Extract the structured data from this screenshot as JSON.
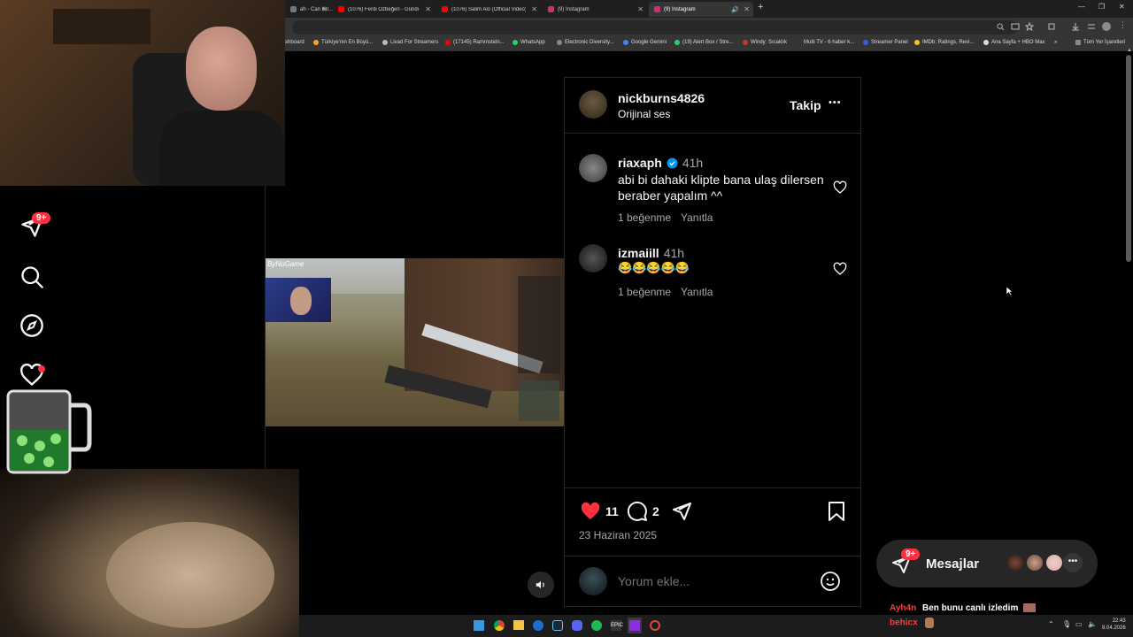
{
  "browser": {
    "tabs": [
      {
        "label": "ah - Can Kır...",
        "fav": "#777"
      },
      {
        "label": "(1076) Ferdi Özbeğen - Gündo...",
        "fav": "#ff0000"
      },
      {
        "label": "(1076) Salim Alo (Official Video)...",
        "fav": "#ff0000"
      },
      {
        "label": "(9) Instagram",
        "fav": "#d62976"
      },
      {
        "label": "(9) Instagram",
        "fav": "#d62976"
      }
    ],
    "new_tab": "+",
    "window_controls": [
      "—",
      "❐",
      "✕"
    ],
    "bookmarks": [
      {
        "label": "shboard",
        "color": "#888"
      },
      {
        "label": "Türkiye'nin En Büyü...",
        "color": "#f5a623"
      },
      {
        "label": "Livad For Streamers",
        "color": "#bbb"
      },
      {
        "label": "(17145) Rammstein...",
        "color": "#ff0000"
      },
      {
        "label": "WhatsApp",
        "color": "#25d366"
      },
      {
        "label": "Electronic Diversity...",
        "color": "#888"
      },
      {
        "label": "Google Gemini",
        "color": "#4285f4"
      },
      {
        "label": "(19) Alert Box / Stre...",
        "color": "#2ecc71"
      },
      {
        "label": "Windy: Sıcaklık",
        "color": "#c0392b"
      },
      {
        "label": "Multi TV - 6 haber k...",
        "color": "#333"
      },
      {
        "label": "Streamer Panel",
        "color": "#3b5bdb"
      },
      {
        "label": "IMDb: Ratings, Revi...",
        "color": "#f5c518"
      },
      {
        "label": "Ana Sayfa + HBO Max",
        "color": "#ddd"
      },
      {
        "label": "»",
        "color": "#353535"
      },
      {
        "label": "Tüm Yer İşaretleri",
        "color": "#888"
      }
    ]
  },
  "nav": {
    "notifications_badge": "9+"
  },
  "post": {
    "author": "nickburns4826",
    "audio": "Orijinal ses",
    "follow": "Takip",
    "more": "•••",
    "video_watermark": "ByNuGame",
    "comments": [
      {
        "user": "riaxaph",
        "verified": true,
        "time": "41h",
        "text": "abi bi dahaki klipte bana ulaş dilersen beraber yapalım ^^",
        "likes": "1 beğenme",
        "reply": "Yanıtla"
      },
      {
        "user": "izmaiill",
        "verified": false,
        "time": "41h",
        "text": "😂😂😂😂😂",
        "likes": "1 beğenme",
        "reply": "Yanıtla"
      }
    ],
    "like_count": "11",
    "comment_count": "2",
    "date": "23 Haziran 2025",
    "comment_placeholder": "Yorum ekle..."
  },
  "messages": {
    "label": "Mesajlar",
    "badge": "9+"
  },
  "chat_overlay": [
    {
      "user": "Ayh4n",
      "text": "Ben bunu canlı izledim",
      "color": "#ff3a3a"
    },
    {
      "user": "behicx",
      "text": "",
      "color": "#ff3a3a"
    }
  ],
  "taskbar": {
    "time": "22:43",
    "date": "8.04.2026"
  },
  "colors": {
    "like_red": "#ff3040",
    "verified_blue": "#0095f6"
  }
}
